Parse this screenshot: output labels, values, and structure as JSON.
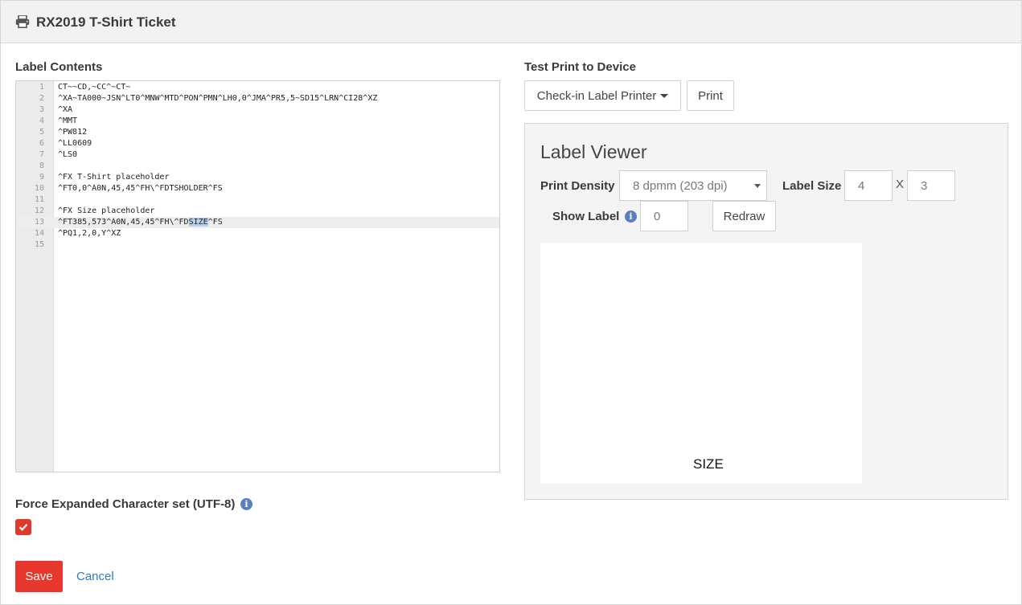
{
  "header": {
    "title": "RX2019 T-Shirt Ticket",
    "icon": "printer-icon"
  },
  "label_contents": {
    "label": "Label Contents",
    "active_line": 13,
    "lines": [
      {
        "n": "1",
        "text": "CT~~CD,~CC^~CT~"
      },
      {
        "n": "2",
        "text": "^XA~TA000~JSN^LT0^MNW^MTD^PON^PMN^LH0,0^JMA^PR5,5~SD15^LRN^CI28^XZ"
      },
      {
        "n": "3",
        "text": "^XA"
      },
      {
        "n": "4",
        "text": "^MMT"
      },
      {
        "n": "5",
        "text": "^PW812"
      },
      {
        "n": "6",
        "text": "^LL0609"
      },
      {
        "n": "7",
        "text": "^LS0"
      },
      {
        "n": "8",
        "text": ""
      },
      {
        "n": "9",
        "text": "^FX T-Shirt placeholder"
      },
      {
        "n": "10",
        "text": "^FT0,0^A0N,45,45^FH\\^FDTSHOLDER^FS"
      },
      {
        "n": "11",
        "text": ""
      },
      {
        "n": "12",
        "text": "^FX Size placeholder"
      },
      {
        "n": "13",
        "text_before": "^FT385,573^A0N,45,45^FH\\^FD",
        "highlight": "SIZE",
        "text_after": "^FS"
      },
      {
        "n": "14",
        "text": "^PQ1,2,0,Y^XZ"
      },
      {
        "n": "15",
        "text": ""
      }
    ]
  },
  "test_print": {
    "label": "Test Print to Device",
    "device": "Check-in Label Printer",
    "print_button": "Print"
  },
  "viewer": {
    "title": "Label Viewer",
    "density_label": "Print Density",
    "density_value": "8 dpmm (203 dpi)",
    "size_label": "Label Size",
    "width": "4",
    "x_separator": "X",
    "height": "3",
    "show_label": "Show Label",
    "show_label_value": "0",
    "redraw_button": "Redraw",
    "preview_text": "SIZE"
  },
  "options": {
    "force_utf8_label": "Force Expanded Character set (UTF-8)",
    "force_utf8_checked": true
  },
  "actions": {
    "save": "Save",
    "cancel": "Cancel"
  },
  "colors": {
    "accent": "#e8372c",
    "link": "#2c7bbf",
    "info": "#5a7fbf"
  }
}
